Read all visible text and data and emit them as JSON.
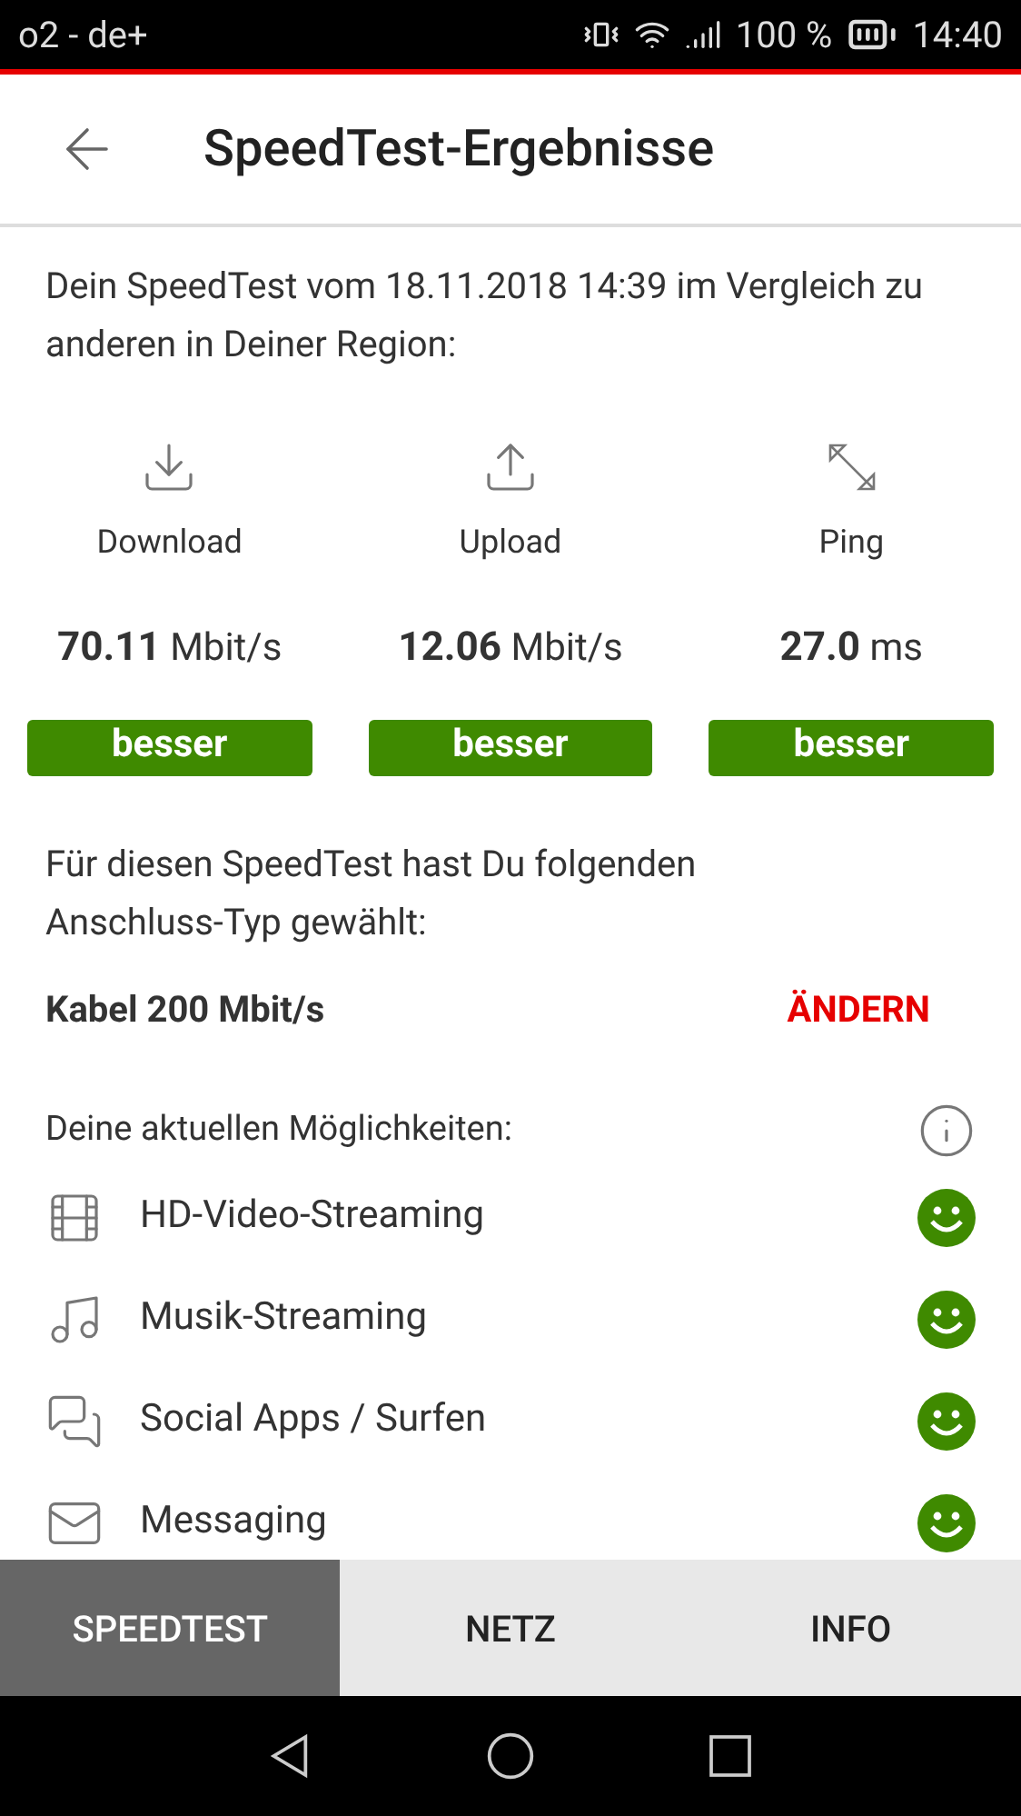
{
  "status_bar": {
    "carrier": "o2 - de+",
    "battery": "100 %",
    "time": "14:40"
  },
  "header": {
    "title": "SpeedTest-Ergebnisse"
  },
  "intro": "Dein SpeedTest vom 18.11.2018 14:39 im Vergleich zu anderen in Deiner Region:",
  "metrics": [
    {
      "kind": "download",
      "label": "Download",
      "value": "70.11",
      "unit": "Mbit/s",
      "rating": "besser"
    },
    {
      "kind": "upload",
      "label": "Upload",
      "value": "12.06",
      "unit": "Mbit/s",
      "rating": "besser"
    },
    {
      "kind": "ping",
      "label": "Ping",
      "value": "27.0",
      "unit": "ms",
      "rating": "besser"
    }
  ],
  "connection": {
    "text": "Für diesen SpeedTest hast Du folgenden Anschluss-Typ gewählt:",
    "type": "Kabel 200 Mbit/s",
    "change_link": "ÄNDERN"
  },
  "capabilities": {
    "title": "Deine aktuellen Möglichkeiten:",
    "items": [
      {
        "kind": "video",
        "label": "HD-Video-Streaming",
        "satisfied": true
      },
      {
        "kind": "music",
        "label": "Musik-Streaming",
        "satisfied": true
      },
      {
        "kind": "chat",
        "label": "Social Apps / Surfen",
        "satisfied": true
      },
      {
        "kind": "mail",
        "label": "Messaging",
        "satisfied": true
      }
    ]
  },
  "tabs": [
    {
      "label": "SPEEDTEST",
      "selected": true
    },
    {
      "label": "NETZ",
      "selected": false
    },
    {
      "label": "INFO",
      "selected": false
    }
  ]
}
